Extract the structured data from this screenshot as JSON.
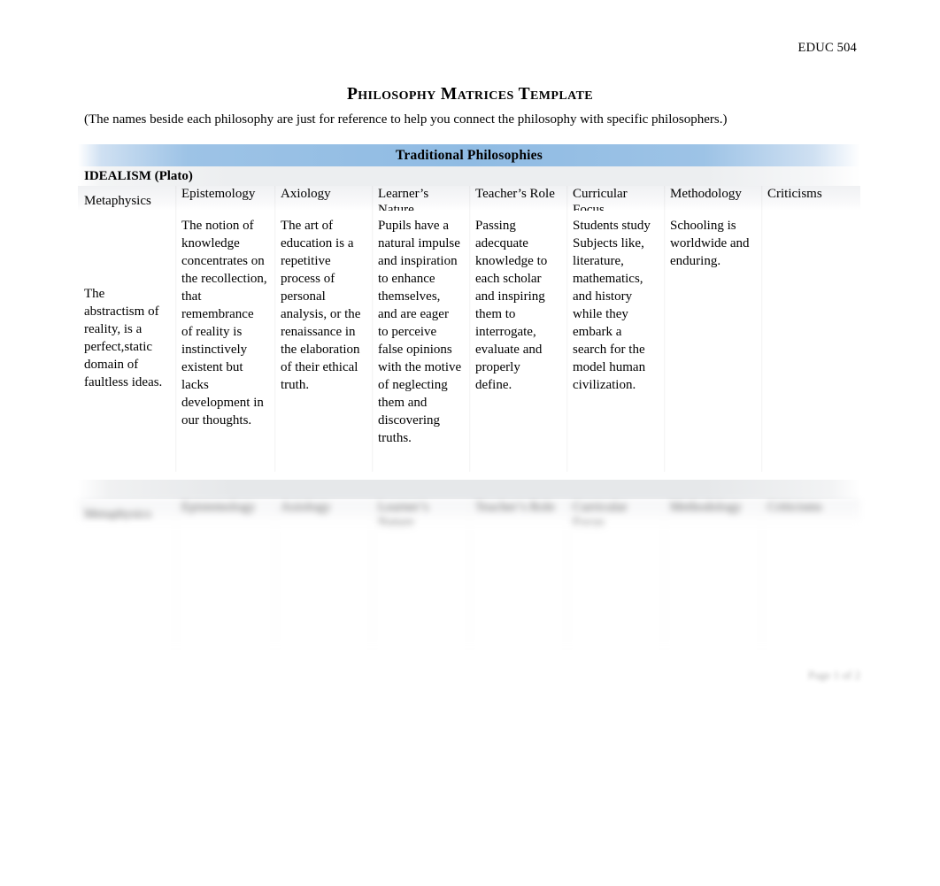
{
  "header": {
    "course_code": "EDUC 504"
  },
  "title": "Philosophy Matrices Template",
  "subtitle_note": "(The names beside each philosophy are just for reference to help you connect the philosophy with specific philosophers.)",
  "colors": {
    "band_accent": "#9dc3e6",
    "band_accent_dark": "#8fbbe3",
    "page_background": "#ffffff",
    "text": "#000000",
    "row_grey": "#e6e8ea"
  },
  "columns": [
    "Metaphysics",
    "Epistemology",
    "Axiology",
    "Learner’s Nature",
    "Teacher’s Role",
    "Curricular Focus",
    "Methodology",
    "Criticisms"
  ],
  "sections": [
    {
      "band_label": "Traditional Philosophies",
      "philosophy_name": "IDEALISM (Plato)",
      "blurred": false,
      "cells": [
        "The abstractism of reality, is a perfect,static domain of faultless ideas.",
        "The notion of knowledge concentrates on the recollection, that remembrance of reality is instinctively existent but lacks development in our thoughts.",
        "The art of education is a repetitive process of personal analysis, or the renaissance in the elaboration of their ethical truth.",
        "Pupils have a natural impulse and inspiration to enhance themselves, and are eager to perceive false opinions with the motive of neglecting them and discovering truths.",
        "Passing adecquate knowledge to each scholar and inspiring them to interrogate, evaluate and properly define.",
        "Students study Subjects like, literature, mathematics, and history while they embark a search for the model human civilization.",
        "Schooling is worldwide and enduring.",
        ""
      ]
    },
    {
      "band_label": "",
      "philosophy_name": "",
      "blurred": true,
      "cells": [
        "",
        "",
        "",
        "",
        "",
        "",
        "",
        ""
      ]
    }
  ],
  "footer": {
    "page_label": "Page 1 of 2"
  }
}
